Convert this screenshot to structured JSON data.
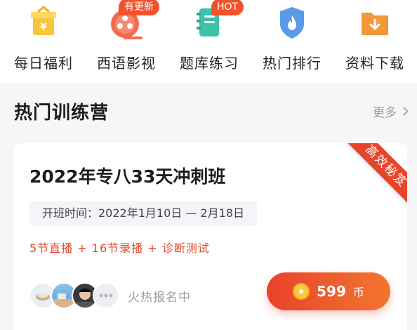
{
  "nav": {
    "items": [
      {
        "label": "每日福利",
        "icon": "gift-icon",
        "badge": ""
      },
      {
        "label": "西语影视",
        "icon": "film-reel-icon",
        "badge": "有更新"
      },
      {
        "label": "题库练习",
        "icon": "notebook-icon",
        "badge": "HOT"
      },
      {
        "label": "热门排行",
        "icon": "flame-shield-icon",
        "badge": ""
      },
      {
        "label": "资料下载",
        "icon": "download-folder-icon",
        "badge": ""
      }
    ]
  },
  "section": {
    "title": "热门训练营",
    "more_label": "更多"
  },
  "card": {
    "ribbon": "高效秘笈",
    "title": "2022年专八33天冲刺班",
    "period": "开班时间：2022年1月10日 — 2月18日",
    "features": "5节直播 + 16节录播 + 诊断测试",
    "enroll_status": "火热报名中",
    "price": "599",
    "currency": "币"
  },
  "colors": {
    "accent": "#e8442a",
    "icon_yellow": "#f8c63a",
    "icon_teal": "#3cc2a8",
    "icon_blue": "#5b9ae8",
    "icon_orange": "#f4963a"
  }
}
